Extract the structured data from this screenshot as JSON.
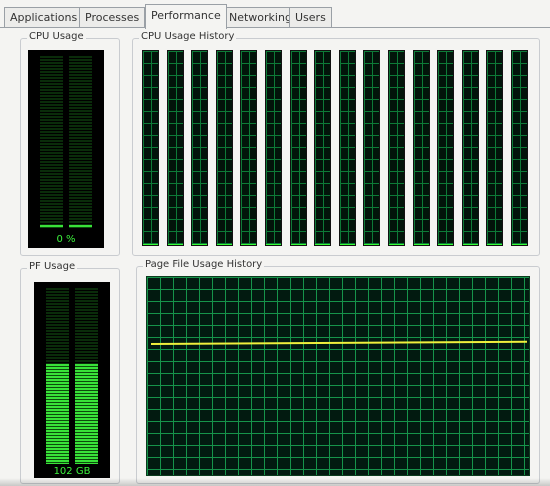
{
  "tabs": [
    {
      "label": "Applications",
      "active": false
    },
    {
      "label": "Processes",
      "active": false
    },
    {
      "label": "Performance",
      "active": true
    },
    {
      "label": "Networking",
      "active": false
    },
    {
      "label": "Users",
      "active": false
    }
  ],
  "cpu_usage": {
    "title": "CPU Usage",
    "value_text": "0 %",
    "level": 0.0
  },
  "cpu_history": {
    "title": "CPU Usage History",
    "cores": 16,
    "load": 0.0
  },
  "pf_usage": {
    "title": "PF Usage",
    "value_text": "102 GB",
    "level": 0.57
  },
  "pf_history": {
    "title": "Page File Usage History",
    "level": 0.67
  },
  "colors": {
    "meter_green": "#39e239",
    "grid_green": "#16934a",
    "pf_line": "#f0f03c",
    "background": "#f4f4f2"
  }
}
